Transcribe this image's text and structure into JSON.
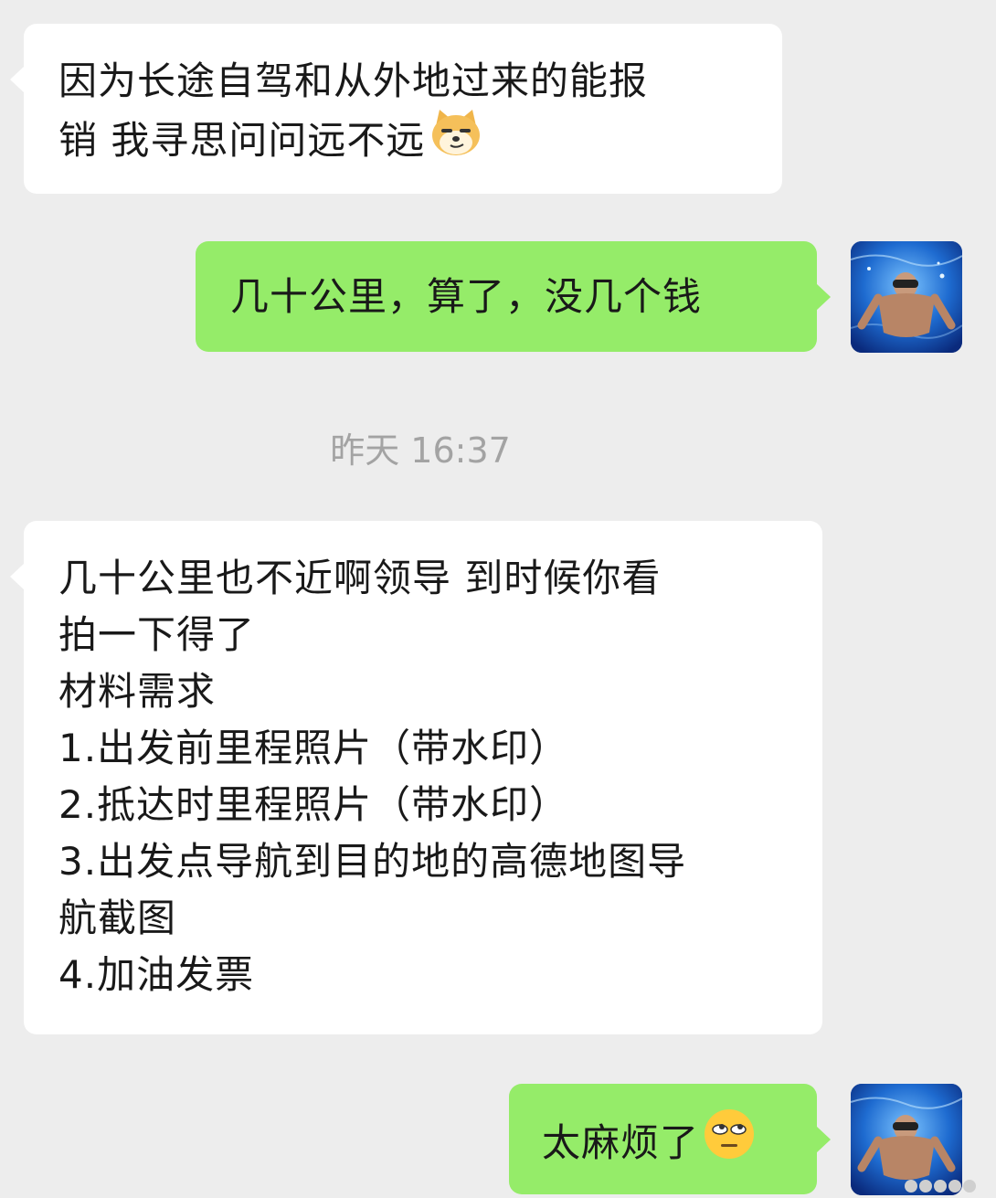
{
  "messages": [
    {
      "side": "left",
      "lines": [
        "因为长途自驾和从外地过来的能报",
        "销  我寻思问问远不远"
      ],
      "emoji": "shiba-dog-smirk-icon"
    },
    {
      "side": "right",
      "lines": [
        "几十公里，算了，没几个钱"
      ]
    },
    {
      "side": "left",
      "lines": [
        "几十公里也不近啊领导 到时候你看",
        "拍一下得了",
        "材料需求",
        "1.出发前里程照片（带水印）",
        "2.抵达时里程照片（带水印）",
        "3.出发点导航到目的地的高德地图导",
        "航截图",
        "4.加油发票"
      ]
    },
    {
      "side": "right",
      "lines": [
        "太麻烦了"
      ],
      "emoji": "eye-roll-face-icon"
    }
  ],
  "timestamp": "昨天 16:37",
  "colors": {
    "background": "#ededed",
    "incoming_bubble": "#ffffff",
    "outgoing_bubble": "#95ec69",
    "timestamp_text": "#a3a3a3"
  },
  "avatar": {
    "icon": "swimmer-underwater-avatar"
  }
}
